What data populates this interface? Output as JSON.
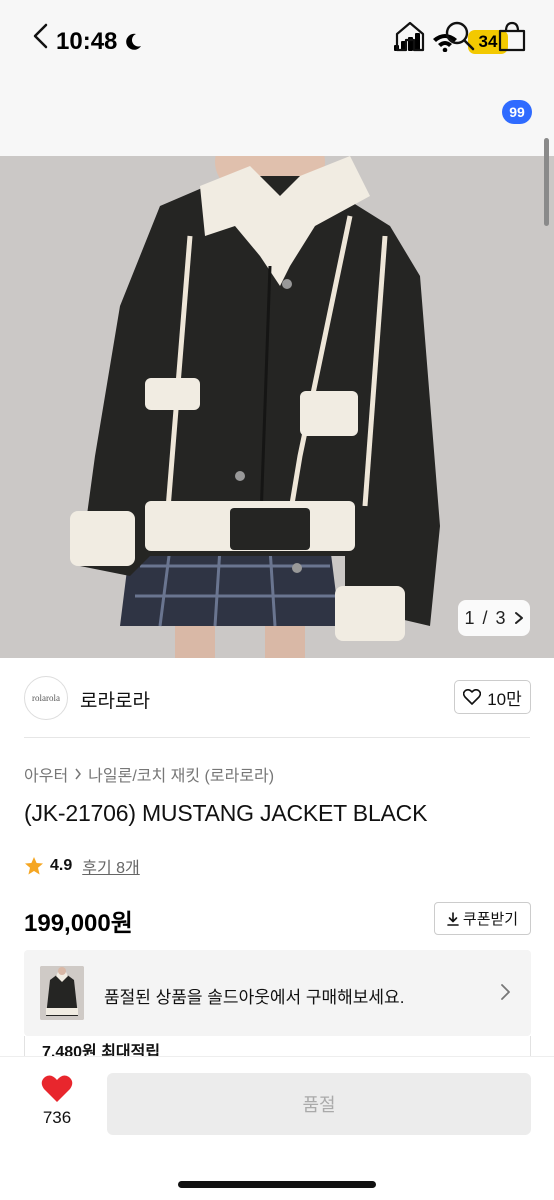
{
  "status_bar": {
    "time": "10:48",
    "battery": "34",
    "icons": [
      "moon-icon",
      "signal-icon",
      "wifi-icon",
      "battery-icon"
    ]
  },
  "nav": {
    "icons": [
      "back-icon",
      "home-icon",
      "search-icon",
      "cart-icon"
    ],
    "cart_badge": "99"
  },
  "product_image": {
    "counter_current": "1",
    "counter_sep": "/",
    "counter_total": "3"
  },
  "brand": {
    "logo_text": "rolarola",
    "name": "로라로라",
    "like_count": "10만"
  },
  "breadcrumb": {
    "category": "아우터",
    "subcategory": "나일론/코치 재킷 (로라로라)"
  },
  "product": {
    "title": "(JK-21706) MUSTANG JACKET BLACK",
    "rating": "4.9",
    "review_text": "후기 8개",
    "price": "199,000원",
    "coupon_label": "쿠폰받기"
  },
  "soldout_banner": {
    "text": "품절된 상품을 솔드아웃에서 구매해보세요."
  },
  "points": {
    "text": "7,480원 최대적립"
  },
  "bottom_bar": {
    "wish_count": "736",
    "buy_label": "품절"
  },
  "colors": {
    "accent_badge": "#2f6bff",
    "heart": "#e8262d",
    "star": "#f5a623",
    "battery": "#f3c900"
  }
}
